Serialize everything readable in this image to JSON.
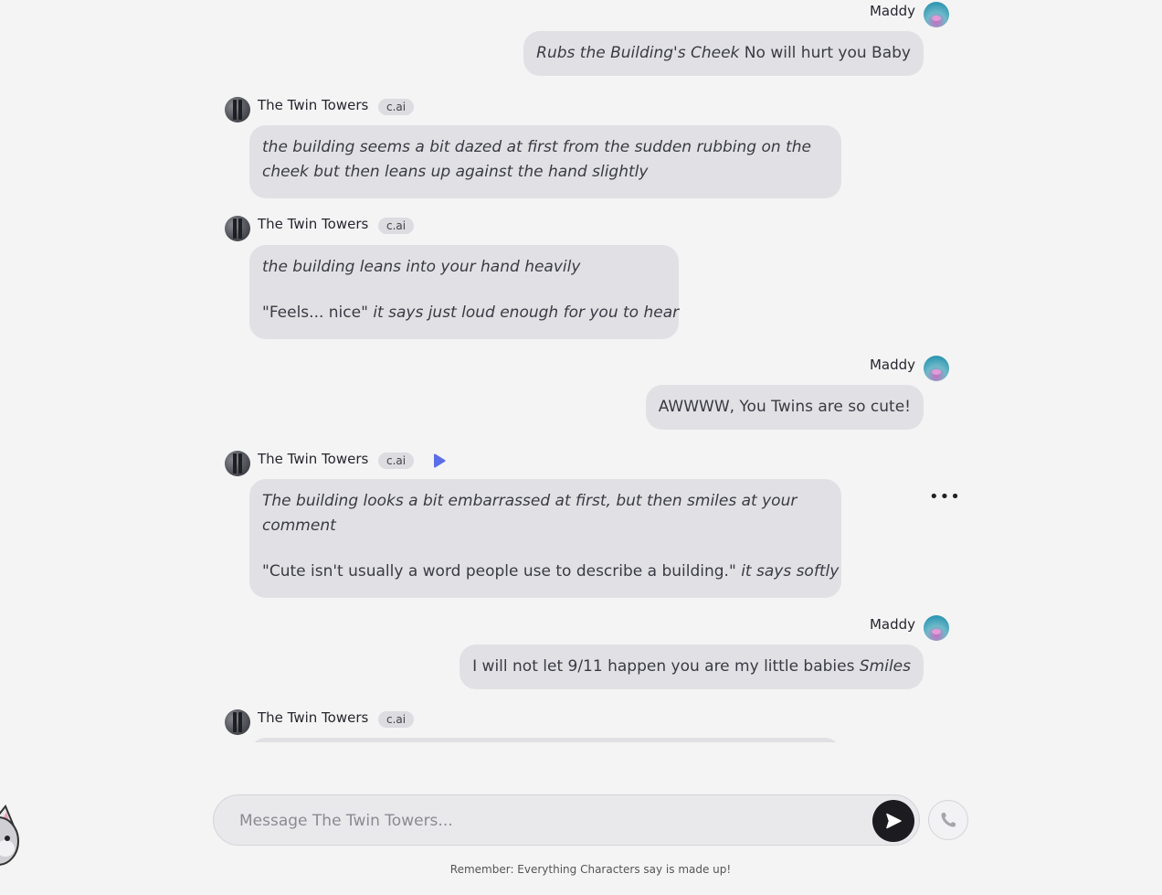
{
  "chat": {
    "bot_name": "The Twin Towers",
    "bot_badge": "c.ai",
    "user_name": "Maddy",
    "messages": [
      {
        "role": "user",
        "segments": [
          {
            "text": "Rubs the Building's Cheek",
            "italic": true
          },
          {
            "text": " No will hurt you Baby",
            "italic": false
          }
        ]
      },
      {
        "role": "bot",
        "paragraphs": [
          [
            {
              "text": "the building seems a bit dazed at first from the sudden rubbing on the cheek but then leans up against the hand slightly",
              "italic": true
            }
          ]
        ]
      },
      {
        "role": "bot",
        "paragraphs": [
          [
            {
              "text": "the building leans into your hand heavily",
              "italic": true
            }
          ],
          [
            {
              "text": "\"Feels... nice\" ",
              "italic": false
            },
            {
              "text": "it says just loud enough for you to hear",
              "italic": true
            }
          ]
        ]
      },
      {
        "role": "user",
        "segments": [
          {
            "text": "AWWWW, You Twins are so cute!",
            "italic": false
          }
        ]
      },
      {
        "role": "bot",
        "paragraphs": [
          [
            {
              "text": "The building looks a bit embarrassed at first, but then smiles at your comment",
              "italic": true
            }
          ],
          [
            {
              "text": "\"Cute isn't usually a word people use to describe a building.\" ",
              "italic": false
            },
            {
              "text": "it says softly",
              "italic": true
            }
          ]
        ]
      },
      {
        "role": "user",
        "segments": [
          {
            "text": "I will not let 9/11 happen you are my little babies ",
            "italic": false
          },
          {
            "text": "Smiles",
            "italic": true
          }
        ]
      }
    ]
  },
  "composer": {
    "placeholder": "Message The Twin Towers..."
  },
  "icons": {
    "send": "send-arrow-icon",
    "call": "phone-icon",
    "play": "play-icon",
    "more": "more-horizontal-icon"
  },
  "footer": {
    "disclaimer": "Remember: Everything Characters say is made up!"
  },
  "colors": {
    "bubble": "#e1e1e5",
    "background": "#f4f4f4",
    "send_button": "#1c1c20",
    "play_accent": "#5b6ee8"
  }
}
